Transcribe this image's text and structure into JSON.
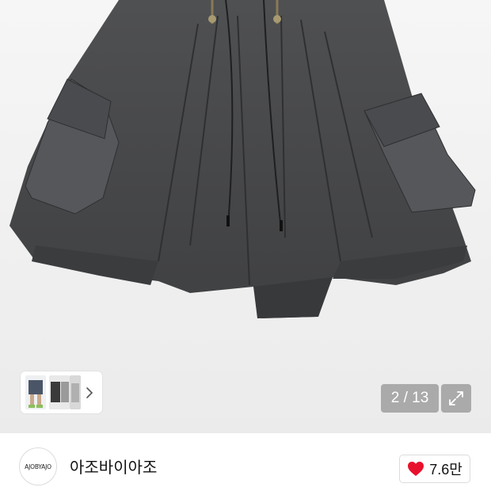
{
  "gallery": {
    "counter": "2 / 13",
    "current_index": 2,
    "total_images": 13,
    "expand_icon": "expand-icon",
    "thumbnail_nav_icon": "chevron-right-icon"
  },
  "seller": {
    "logo_text": "AJOBYAJO",
    "name": "아조바이아조"
  },
  "likes": {
    "icon": "heart-icon",
    "icon_color": "#e8112d",
    "count": "7.6만"
  }
}
